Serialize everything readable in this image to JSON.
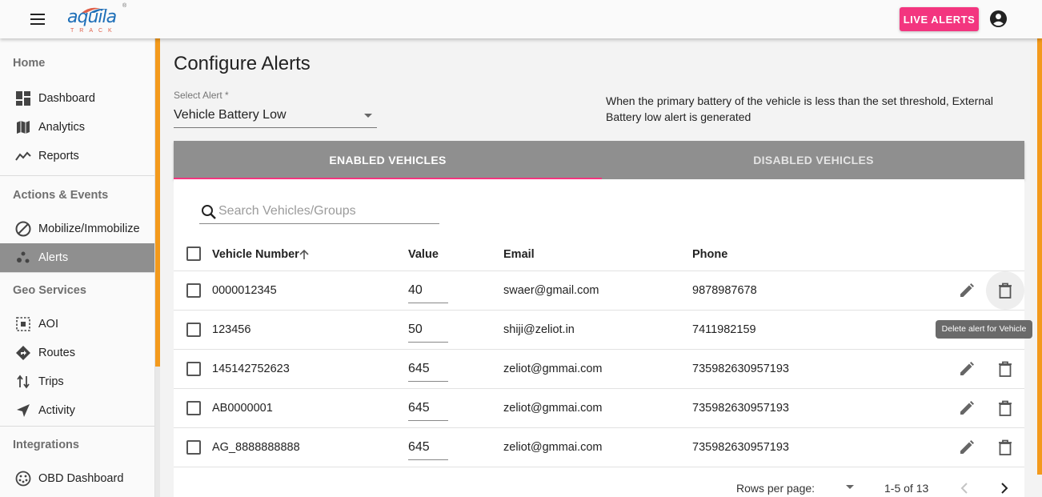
{
  "header": {
    "logo_text": "aquila",
    "logo_sub": "TRACK",
    "logo_reg": "®",
    "live_alerts_label": "LIVE ALERTS"
  },
  "sidebar": {
    "home_label": "Home",
    "groups": [
      {
        "label": "",
        "items": [
          {
            "label": "Dashboard",
            "icon": "dashboard-icon"
          },
          {
            "label": "Analytics",
            "icon": "map-icon"
          },
          {
            "label": "Reports",
            "icon": "trending-icon"
          }
        ]
      },
      {
        "label": "Actions & Events",
        "items": [
          {
            "label": "Mobilize/Immobilize",
            "icon": "block-icon"
          },
          {
            "label": "Alerts",
            "icon": "bubbles-icon"
          }
        ]
      },
      {
        "label": "Geo Services",
        "items": [
          {
            "label": "AOI",
            "icon": "select-area-icon"
          },
          {
            "label": "Routes",
            "icon": "directions-icon"
          },
          {
            "label": "Trips",
            "icon": "swap-vert-icon"
          },
          {
            "label": "Activity",
            "icon": "navigation-icon"
          }
        ]
      },
      {
        "label": "Integrations",
        "items": [
          {
            "label": "OBD Dashboard",
            "icon": "obd-icon"
          }
        ]
      }
    ],
    "active_item": "Alerts"
  },
  "main": {
    "title": "Configure Alerts",
    "select_label": "Select Alert *",
    "select_value": "Vehicle Battery Low",
    "description": "When the primary battery of the vehicle is less than the set threshold, External Battery low alert is generated",
    "tabs": [
      {
        "label": "ENABLED VEHICLES",
        "active": true
      },
      {
        "label": "DISABLED VEHICLES",
        "active": false
      }
    ],
    "search_placeholder": "Search Vehicles/Groups",
    "columns": [
      "Vehicle Number",
      "Value",
      "Email",
      "Phone"
    ],
    "rows": [
      {
        "vehicle": "0000012345",
        "value": "40",
        "email": "swaer@gmail.com",
        "phone": "9878987678"
      },
      {
        "vehicle": "123456",
        "value": "50",
        "email": "shiji@zeliot.in",
        "phone": "7411982159"
      },
      {
        "vehicle": "145142752623",
        "value": "645",
        "email": "zeliot@gmmai.com",
        "phone": "735982630957193"
      },
      {
        "vehicle": "AB0000001",
        "value": "645",
        "email": "zeliot@gmmai.com",
        "phone": "735982630957193"
      },
      {
        "vehicle": "AG_8888888888",
        "value": "645",
        "email": "zeliot@gmmai.com",
        "phone": "735982630957193"
      }
    ],
    "tooltip": "Delete alert for Vehicle",
    "footer": {
      "rows_per_page_label": "Rows per page:",
      "range": "1-5 of 13"
    }
  },
  "colors": {
    "accent_pink": "#f3357f",
    "orange_strip": "#f39a1d",
    "tab_bg": "#8f8f8f",
    "logo_blue": "#1e6fb8"
  }
}
